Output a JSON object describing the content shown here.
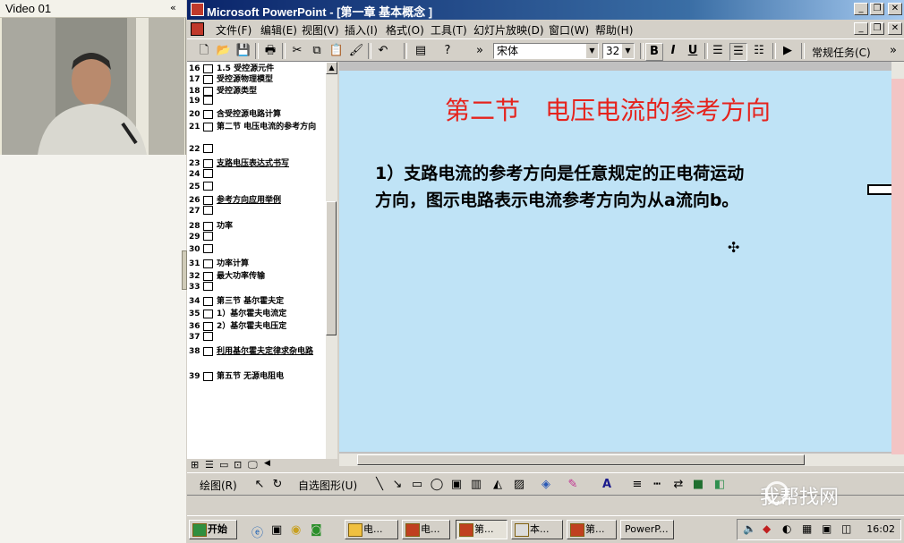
{
  "video_pane": {
    "title": "Video 01",
    "collapse_glyph": "«"
  },
  "window": {
    "title": "Microsoft PowerPoint - [第一章 基本概念 ]",
    "controls": [
      "_",
      "❐",
      "✕"
    ]
  },
  "menu": [
    "文件(F)",
    "编辑(E)",
    "视图(V)",
    "插入(I)",
    "格式(O)",
    "工具(T)",
    "幻灯片放映(D)",
    "窗口(W)",
    "帮助(H)"
  ],
  "doc_controls": [
    "_",
    "❐",
    "✕"
  ],
  "toolbar": {
    "font_name": "宋体",
    "font_size": "32",
    "bold": "B",
    "italic": "I",
    "underline": "U",
    "tasks_label": "常规任务(C)"
  },
  "outline": [
    {
      "num": "16",
      "text": "1.5 受控源元件"
    },
    {
      "num": "17",
      "text": "受控源物理模型"
    },
    {
      "num": "18",
      "text": "受控源类型"
    },
    {
      "num": "19",
      "text": ""
    },
    {
      "num": "20",
      "text": "含受控源电路计算"
    },
    {
      "num": "21",
      "text": "第二节 电压电流的参考方向"
    },
    {
      "num": "22",
      "text": ""
    },
    {
      "num": "23",
      "text": "支路电压表达式书写"
    },
    {
      "num": "24",
      "text": ""
    },
    {
      "num": "25",
      "text": ""
    },
    {
      "num": "26",
      "text": "参考方向应用举例"
    },
    {
      "num": "27",
      "text": ""
    },
    {
      "num": "28",
      "text": "功率"
    },
    {
      "num": "29",
      "text": ""
    },
    {
      "num": "30",
      "text": ""
    },
    {
      "num": "31",
      "text": "功率计算"
    },
    {
      "num": "32",
      "text": "最大功率传输"
    },
    {
      "num": "33",
      "text": ""
    },
    {
      "num": "34",
      "text": "第三节 基尔霍夫定"
    },
    {
      "num": "35",
      "text": "1）基尔霍夫电流定"
    },
    {
      "num": "36",
      "text": "2）基尔霍夫电压定"
    },
    {
      "num": "37",
      "text": ""
    },
    {
      "num": "38",
      "text": "利用基尔霍夫定律求杂电路"
    },
    {
      "num": "39",
      "text": "第五节 无源电阻电"
    }
  ],
  "slide": {
    "title": "第二节　电压电流的参考方向",
    "body": "1）支路电流的参考方向是任意规定的正电荷运动方向，图示电路表示电流参考方向为从a流向b。"
  },
  "drawbar": {
    "draw_label": "绘图(R)",
    "autoshapes_label": "自选图形(U)"
  },
  "taskbar": {
    "start_label": "开始",
    "tasks": [
      "电...",
      "电...",
      "第...",
      "本...",
      "第...",
      "PowerP..."
    ],
    "clock": "16:02"
  },
  "watermark": "我帮找网",
  "colors": {
    "slide_bg": "#bfe3f6",
    "title_red": "#e5231d",
    "titlebar": "#0a246a"
  }
}
